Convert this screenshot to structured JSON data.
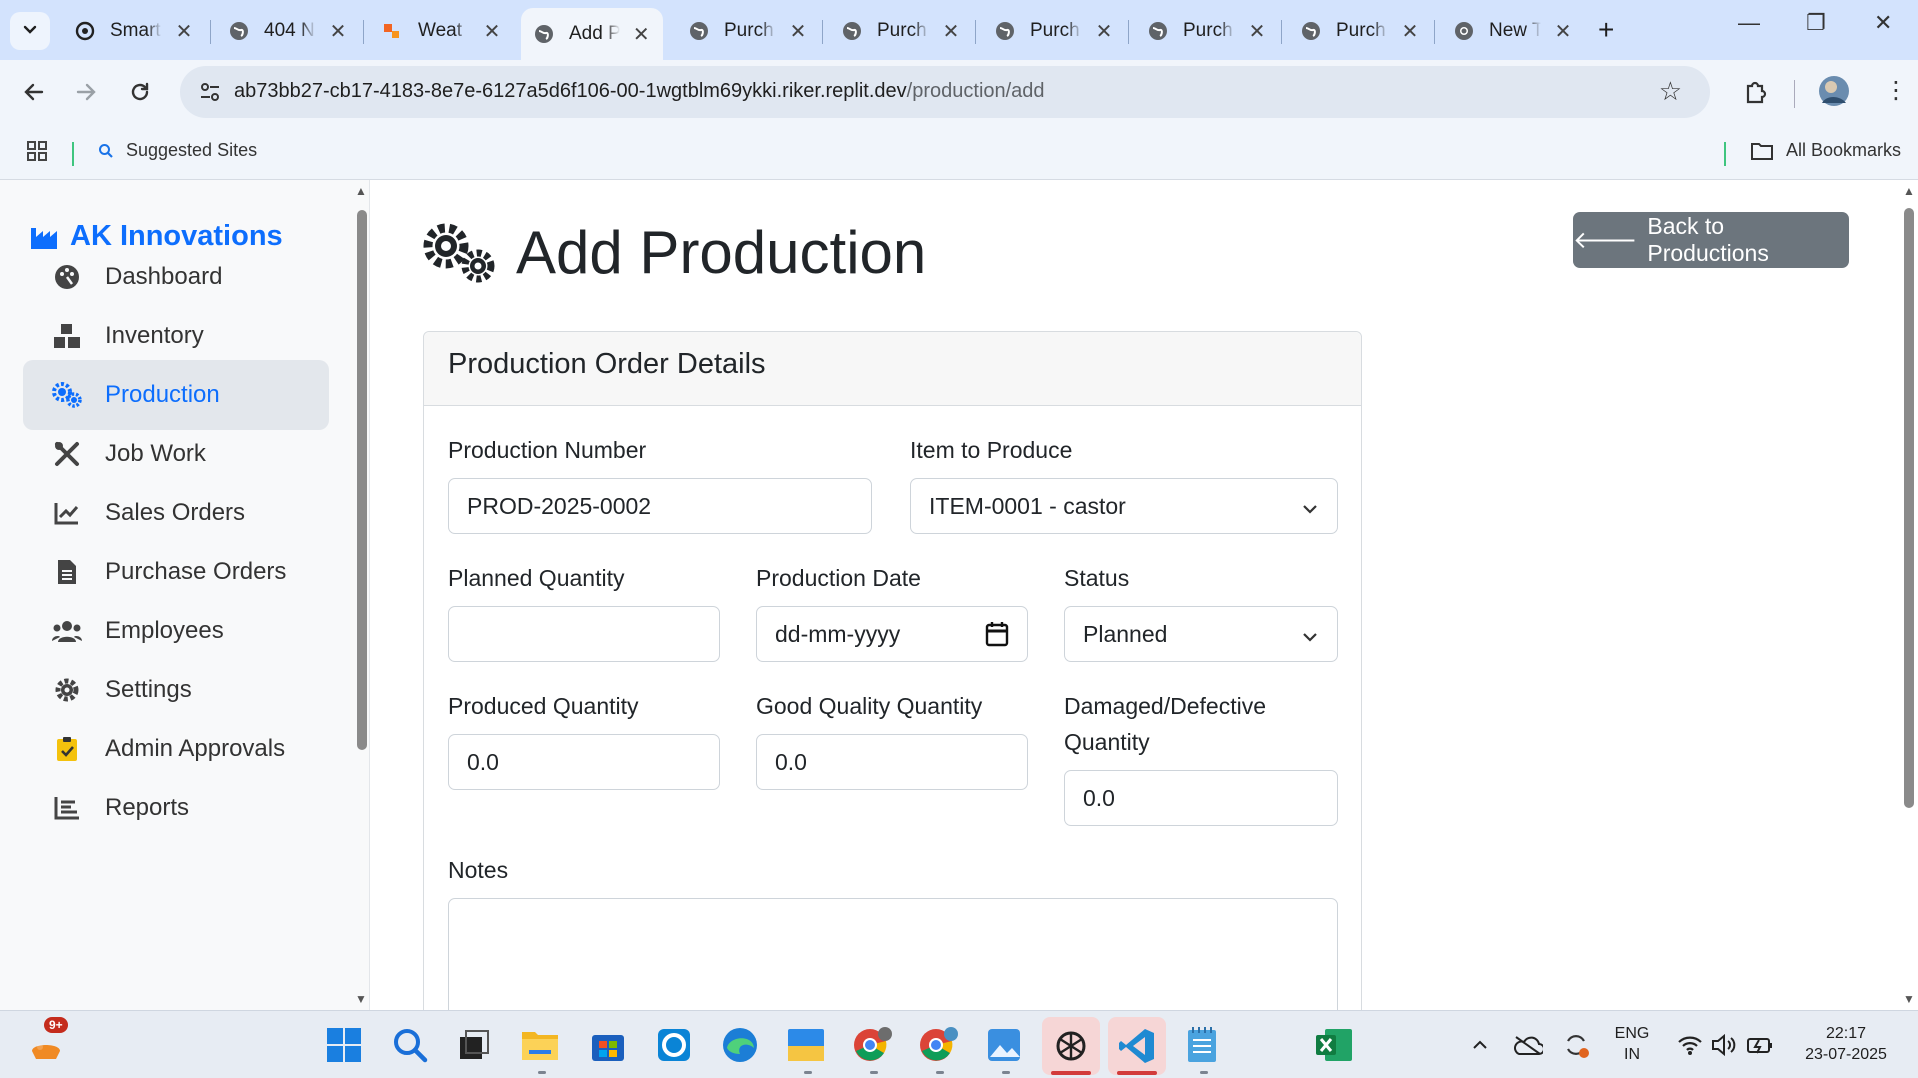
{
  "browser": {
    "tabs": [
      {
        "title": "Smart",
        "icon": "openai-icon"
      },
      {
        "title": "404 N",
        "icon": "globe-icon"
      },
      {
        "title": "Weat",
        "icon": "weather-icon"
      },
      {
        "title": "Add P",
        "icon": "globe-icon",
        "active": true
      },
      {
        "title": "Purch",
        "icon": "globe-icon"
      },
      {
        "title": "Purch",
        "icon": "globe-icon"
      },
      {
        "title": "Purch",
        "icon": "globe-icon"
      },
      {
        "title": "Purch",
        "icon": "globe-icon"
      },
      {
        "title": "Purch",
        "icon": "globe-icon"
      },
      {
        "title": "New T",
        "icon": "chrome-icon"
      }
    ],
    "url_host": "ab73bb27-cb17-4183-8e7e-6127a5d6f106-00-1wgtblm69ykki.riker.replit.dev",
    "url_path": "/production/add",
    "bookmarks": {
      "suggested": "Suggested Sites",
      "all": "All Bookmarks"
    }
  },
  "app": {
    "brand": "AK Innovations",
    "nav": [
      {
        "label": "Dashboard",
        "icon": "palette-icon"
      },
      {
        "label": "Inventory",
        "icon": "boxes-icon"
      },
      {
        "label": "Production",
        "icon": "cogs-icon",
        "active": true
      },
      {
        "label": "Job Work",
        "icon": "tools-icon"
      },
      {
        "label": "Sales Orders",
        "icon": "chart-line-icon"
      },
      {
        "label": "Purchase Orders",
        "icon": "document-icon"
      },
      {
        "label": "Employees",
        "icon": "users-icon"
      },
      {
        "label": "Settings",
        "icon": "gear-icon"
      },
      {
        "label": "Admin Approvals",
        "icon": "clipboard-check-icon"
      },
      {
        "label": "Reports",
        "icon": "bar-chart-icon"
      }
    ]
  },
  "page": {
    "title": "Add Production",
    "back_button": "Back to Productions",
    "card_title": "Production Order Details",
    "form": {
      "production_number": {
        "label": "Production Number",
        "value": "PROD-2025-0002"
      },
      "item": {
        "label": "Item to Produce",
        "value": "ITEM-0001 - castor"
      },
      "planned_quantity": {
        "label": "Planned Quantity",
        "value": ""
      },
      "production_date": {
        "label": "Production Date",
        "placeholder": "dd-mm-yyyy"
      },
      "status": {
        "label": "Status",
        "value": "Planned"
      },
      "produced_quantity": {
        "label": "Produced Quantity",
        "value": "0.0"
      },
      "good_quantity": {
        "label": "Good Quality Quantity",
        "value": "0.0"
      },
      "damaged_quantity": {
        "label": "Damaged/Defective Quantity",
        "value": "0.0"
      },
      "notes": {
        "label": "Notes",
        "value": ""
      }
    }
  },
  "taskbar": {
    "notification_badge": "9+",
    "lang_line1": "ENG",
    "lang_line2": "IN",
    "time": "22:17",
    "date": "23-07-2025"
  }
}
